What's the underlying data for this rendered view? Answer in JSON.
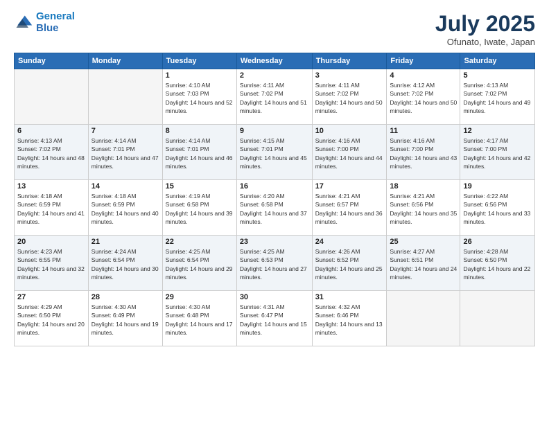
{
  "logo": {
    "line1": "General",
    "line2": "Blue"
  },
  "title": "July 2025",
  "location": "Ofunato, Iwate, Japan",
  "headers": [
    "Sunday",
    "Monday",
    "Tuesday",
    "Wednesday",
    "Thursday",
    "Friday",
    "Saturday"
  ],
  "weeks": [
    [
      {
        "day": "",
        "sunrise": "",
        "sunset": "",
        "daylight": "",
        "empty": true
      },
      {
        "day": "",
        "sunrise": "",
        "sunset": "",
        "daylight": "",
        "empty": true
      },
      {
        "day": "1",
        "sunrise": "Sunrise: 4:10 AM",
        "sunset": "Sunset: 7:03 PM",
        "daylight": "Daylight: 14 hours and 52 minutes."
      },
      {
        "day": "2",
        "sunrise": "Sunrise: 4:11 AM",
        "sunset": "Sunset: 7:02 PM",
        "daylight": "Daylight: 14 hours and 51 minutes."
      },
      {
        "day": "3",
        "sunrise": "Sunrise: 4:11 AM",
        "sunset": "Sunset: 7:02 PM",
        "daylight": "Daylight: 14 hours and 50 minutes."
      },
      {
        "day": "4",
        "sunrise": "Sunrise: 4:12 AM",
        "sunset": "Sunset: 7:02 PM",
        "daylight": "Daylight: 14 hours and 50 minutes."
      },
      {
        "day": "5",
        "sunrise": "Sunrise: 4:13 AM",
        "sunset": "Sunset: 7:02 PM",
        "daylight": "Daylight: 14 hours and 49 minutes."
      }
    ],
    [
      {
        "day": "6",
        "sunrise": "Sunrise: 4:13 AM",
        "sunset": "Sunset: 7:02 PM",
        "daylight": "Daylight: 14 hours and 48 minutes."
      },
      {
        "day": "7",
        "sunrise": "Sunrise: 4:14 AM",
        "sunset": "Sunset: 7:01 PM",
        "daylight": "Daylight: 14 hours and 47 minutes."
      },
      {
        "day": "8",
        "sunrise": "Sunrise: 4:14 AM",
        "sunset": "Sunset: 7:01 PM",
        "daylight": "Daylight: 14 hours and 46 minutes."
      },
      {
        "day": "9",
        "sunrise": "Sunrise: 4:15 AM",
        "sunset": "Sunset: 7:01 PM",
        "daylight": "Daylight: 14 hours and 45 minutes."
      },
      {
        "day": "10",
        "sunrise": "Sunrise: 4:16 AM",
        "sunset": "Sunset: 7:00 PM",
        "daylight": "Daylight: 14 hours and 44 minutes."
      },
      {
        "day": "11",
        "sunrise": "Sunrise: 4:16 AM",
        "sunset": "Sunset: 7:00 PM",
        "daylight": "Daylight: 14 hours and 43 minutes."
      },
      {
        "day": "12",
        "sunrise": "Sunrise: 4:17 AM",
        "sunset": "Sunset: 7:00 PM",
        "daylight": "Daylight: 14 hours and 42 minutes."
      }
    ],
    [
      {
        "day": "13",
        "sunrise": "Sunrise: 4:18 AM",
        "sunset": "Sunset: 6:59 PM",
        "daylight": "Daylight: 14 hours and 41 minutes."
      },
      {
        "day": "14",
        "sunrise": "Sunrise: 4:18 AM",
        "sunset": "Sunset: 6:59 PM",
        "daylight": "Daylight: 14 hours and 40 minutes."
      },
      {
        "day": "15",
        "sunrise": "Sunrise: 4:19 AM",
        "sunset": "Sunset: 6:58 PM",
        "daylight": "Daylight: 14 hours and 39 minutes."
      },
      {
        "day": "16",
        "sunrise": "Sunrise: 4:20 AM",
        "sunset": "Sunset: 6:58 PM",
        "daylight": "Daylight: 14 hours and 37 minutes."
      },
      {
        "day": "17",
        "sunrise": "Sunrise: 4:21 AM",
        "sunset": "Sunset: 6:57 PM",
        "daylight": "Daylight: 14 hours and 36 minutes."
      },
      {
        "day": "18",
        "sunrise": "Sunrise: 4:21 AM",
        "sunset": "Sunset: 6:56 PM",
        "daylight": "Daylight: 14 hours and 35 minutes."
      },
      {
        "day": "19",
        "sunrise": "Sunrise: 4:22 AM",
        "sunset": "Sunset: 6:56 PM",
        "daylight": "Daylight: 14 hours and 33 minutes."
      }
    ],
    [
      {
        "day": "20",
        "sunrise": "Sunrise: 4:23 AM",
        "sunset": "Sunset: 6:55 PM",
        "daylight": "Daylight: 14 hours and 32 minutes."
      },
      {
        "day": "21",
        "sunrise": "Sunrise: 4:24 AM",
        "sunset": "Sunset: 6:54 PM",
        "daylight": "Daylight: 14 hours and 30 minutes."
      },
      {
        "day": "22",
        "sunrise": "Sunrise: 4:25 AM",
        "sunset": "Sunset: 6:54 PM",
        "daylight": "Daylight: 14 hours and 29 minutes."
      },
      {
        "day": "23",
        "sunrise": "Sunrise: 4:25 AM",
        "sunset": "Sunset: 6:53 PM",
        "daylight": "Daylight: 14 hours and 27 minutes."
      },
      {
        "day": "24",
        "sunrise": "Sunrise: 4:26 AM",
        "sunset": "Sunset: 6:52 PM",
        "daylight": "Daylight: 14 hours and 25 minutes."
      },
      {
        "day": "25",
        "sunrise": "Sunrise: 4:27 AM",
        "sunset": "Sunset: 6:51 PM",
        "daylight": "Daylight: 14 hours and 24 minutes."
      },
      {
        "day": "26",
        "sunrise": "Sunrise: 4:28 AM",
        "sunset": "Sunset: 6:50 PM",
        "daylight": "Daylight: 14 hours and 22 minutes."
      }
    ],
    [
      {
        "day": "27",
        "sunrise": "Sunrise: 4:29 AM",
        "sunset": "Sunset: 6:50 PM",
        "daylight": "Daylight: 14 hours and 20 minutes."
      },
      {
        "day": "28",
        "sunrise": "Sunrise: 4:30 AM",
        "sunset": "Sunset: 6:49 PM",
        "daylight": "Daylight: 14 hours and 19 minutes."
      },
      {
        "day": "29",
        "sunrise": "Sunrise: 4:30 AM",
        "sunset": "Sunset: 6:48 PM",
        "daylight": "Daylight: 14 hours and 17 minutes."
      },
      {
        "day": "30",
        "sunrise": "Sunrise: 4:31 AM",
        "sunset": "Sunset: 6:47 PM",
        "daylight": "Daylight: 14 hours and 15 minutes."
      },
      {
        "day": "31",
        "sunrise": "Sunrise: 4:32 AM",
        "sunset": "Sunset: 6:46 PM",
        "daylight": "Daylight: 14 hours and 13 minutes."
      },
      {
        "day": "",
        "sunrise": "",
        "sunset": "",
        "daylight": "",
        "empty": true
      },
      {
        "day": "",
        "sunrise": "",
        "sunset": "",
        "daylight": "",
        "empty": true
      }
    ]
  ]
}
